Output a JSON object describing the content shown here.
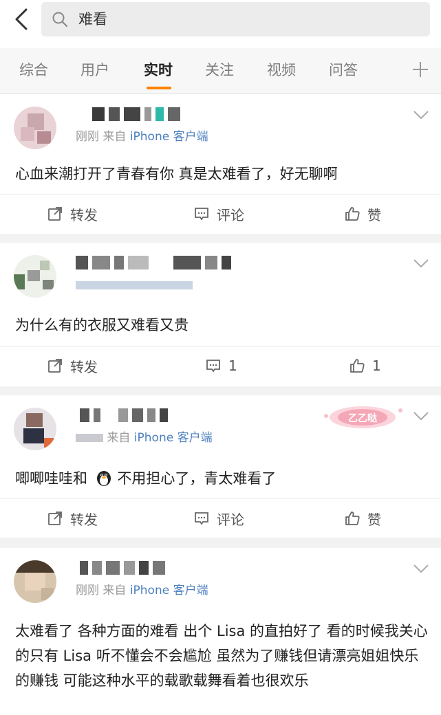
{
  "search": {
    "query": "难看"
  },
  "tabs": [
    {
      "label": "综合"
    },
    {
      "label": "用户"
    },
    {
      "label": "实时"
    },
    {
      "label": "关注"
    },
    {
      "label": "视频"
    },
    {
      "label": "问答"
    }
  ],
  "accent_color": "#ff8200",
  "link_color": "#4c7fbf",
  "posts": [
    {
      "time": "刚刚",
      "source_prefix": "来自",
      "source": "iPhone 客户端",
      "content": "心血来潮打开了青春有你 真是太难看了，好无聊啊",
      "repost_label": "转发",
      "comment_label": "评论",
      "like_label": "赞"
    },
    {
      "time": "",
      "source_prefix": "",
      "source": "",
      "content": "为什么有的衣服又难看又贵",
      "repost_label": "转发",
      "comment_label": "1",
      "like_label": "1"
    },
    {
      "time": "",
      "source_prefix": "来自",
      "source": "iPhone 客户端",
      "content_before": "唧唧哇哇和",
      "content_after": " 不用担心了，青太难看了",
      "emoji_icon": "penguin-icon",
      "badge_text": "乙乙哒",
      "repost_label": "转发",
      "comment_label": "评论",
      "like_label": "赞"
    },
    {
      "time": "刚刚",
      "source_prefix": "来自",
      "source": "iPhone 客户端",
      "content": "太难看了 各种方面的难看 出个 Lisa 的直拍好了 看的时候我关心的只有 Lisa 听不懂会不会尴尬 虽然为了赚钱但请漂亮姐姐快乐的赚钱 可能这种水平的载歌载舞看着也很欢乐"
    }
  ]
}
